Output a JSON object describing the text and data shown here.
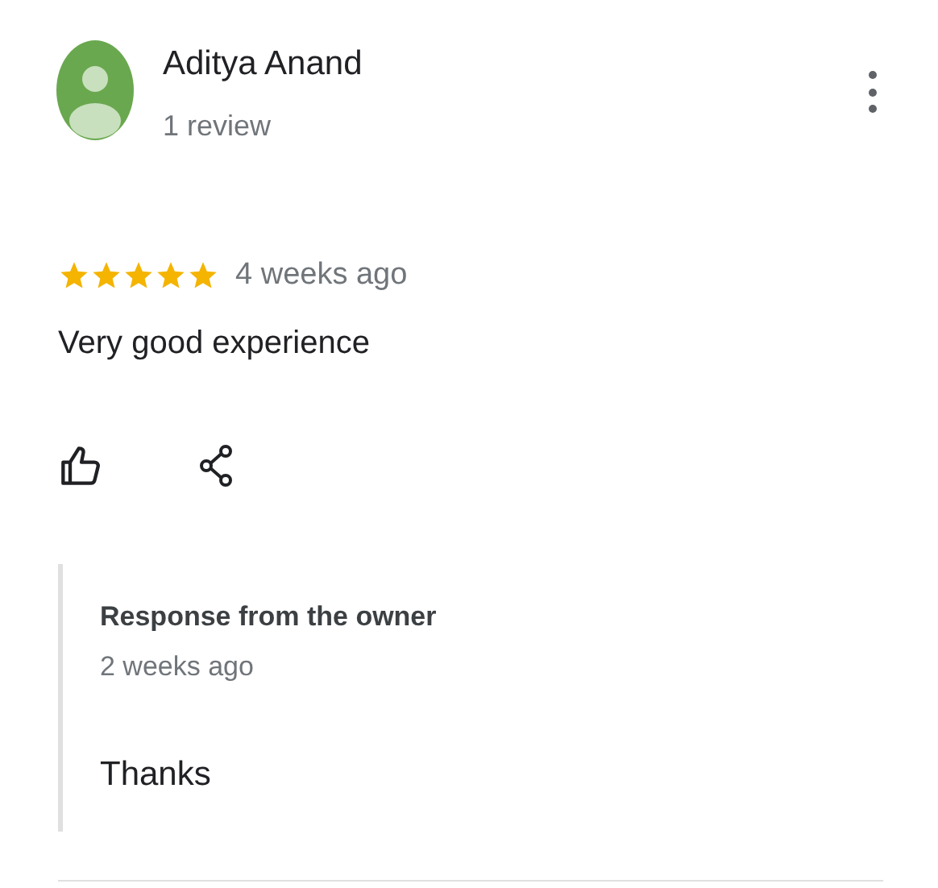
{
  "review": {
    "author": "Aditya Anand",
    "review_count": "1 review",
    "stars": 5,
    "time": "4 weeks ago",
    "text": "Very good experience"
  },
  "owner_response": {
    "title": "Response from the owner",
    "time": "2 weeks ago",
    "text": "Thanks"
  }
}
